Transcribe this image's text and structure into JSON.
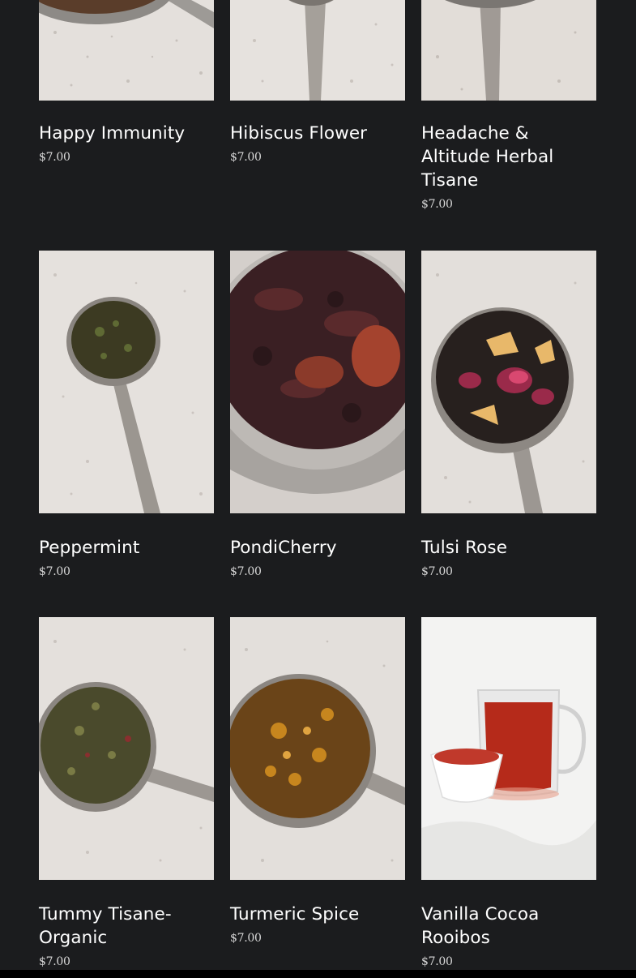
{
  "currency_symbol": "$",
  "products": [
    {
      "name": "Happy Immunity",
      "price": "$7.00",
      "image": "spoon-herbal-blend-red"
    },
    {
      "name": "Hibiscus Flower",
      "price": "$7.00",
      "image": "spoon-hibiscus"
    },
    {
      "name": "Headache & Altitude Herbal Tisane",
      "price": "$7.00",
      "image": "spoon-green-herbs"
    },
    {
      "name": "Peppermint",
      "price": "$7.00",
      "image": "spoon-peppermint"
    },
    {
      "name": "PondiCherry",
      "price": "$7.00",
      "image": "cup-dried-hibiscus-rosehip"
    },
    {
      "name": "Tulsi Rose",
      "price": "$7.00",
      "image": "spoon-tulsi-rose"
    },
    {
      "name": "Tummy Tisane-Organic",
      "price": "$7.00",
      "image": "spoon-fennel-blend"
    },
    {
      "name": "Turmeric Spice",
      "price": "$7.00",
      "image": "spoon-turmeric"
    },
    {
      "name": "Vanilla Cocoa Rooibos",
      "price": "$7.00",
      "image": "glass-teapot-rooibos"
    }
  ],
  "colors": {
    "background": "#1b1c1e",
    "title": "#ffffff",
    "price": "#d9d9d9",
    "counter": "#e6e2de"
  }
}
